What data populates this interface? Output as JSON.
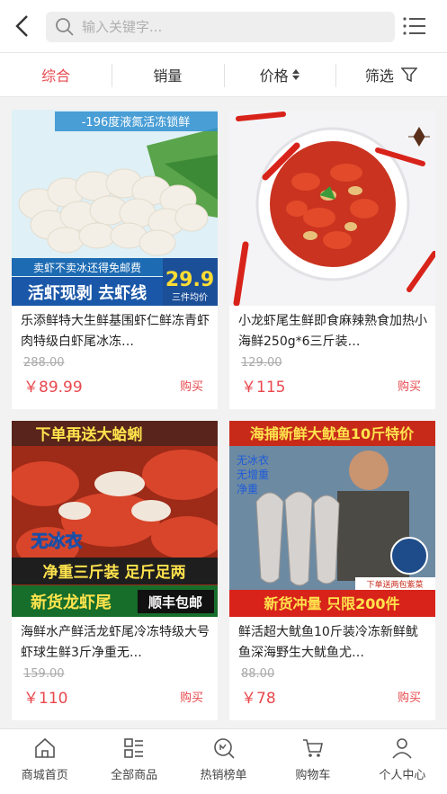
{
  "search": {
    "placeholder": "输入关键字..."
  },
  "sortbar": {
    "items": [
      {
        "label": "综合",
        "active": true
      },
      {
        "label": "销量"
      },
      {
        "label": "价格"
      },
      {
        "label": "筛选"
      }
    ]
  },
  "products": [
    {
      "title": "乐添鲜特大生鲜基围虾仁鲜冻青虾肉特级白虾尾冰冻…",
      "old_price": "288.00",
      "price": "￥89.99",
      "buy": "购买",
      "banner_top": "-196度液氮活冻锁鲜",
      "banner_mid": "卖虾不卖冰还得免邮费",
      "banner_bottom": "活虾现剥 去虾线",
      "badge_price": "29.9",
      "badge_sub": "三件均价"
    },
    {
      "title": "小龙虾尾生鲜即食麻辣熟食加热小海鲜250g*6三斤装…",
      "old_price": "129.00",
      "price": "￥115",
      "buy": "购买"
    },
    {
      "title": "海鲜水产鲜活龙虾尾冷冻特级大号虾球生鲜3斤净重无…",
      "old_price": "159.00",
      "price": "￥110",
      "buy": "购买",
      "banner_top": "下单再送大蛤蜊",
      "banner_mid": "无冰衣",
      "banner_line2": "净重三斤装  足斤足两",
      "banner_bottom": "新货龙虾尾",
      "banner_badge": "顺丰包邮"
    },
    {
      "title": "鲜活超大鱿鱼10斤装冷冻新鲜鱿鱼深海野生大鱿鱼尤…",
      "old_price": "88.00",
      "price": "￥78",
      "buy": "购买",
      "banner_top": "海捕新鲜大鱿鱼10斤特价",
      "banner_checks": [
        "无冰衣",
        "无增重",
        "净重"
      ],
      "banner_tag": "下单送两包紫菜",
      "banner_bottom": "新货冲量  只限200件"
    }
  ],
  "tabbar": {
    "items": [
      {
        "label": "商城首页",
        "icon": "home-icon"
      },
      {
        "label": "全部商品",
        "icon": "grid-list-icon"
      },
      {
        "label": "热销榜单",
        "icon": "hot-search-icon"
      },
      {
        "label": "购物车",
        "icon": "cart-icon"
      },
      {
        "label": "个人中心",
        "icon": "user-icon"
      }
    ]
  },
  "colors": {
    "accent": "#e8484d",
    "background": "#f2f2f2"
  }
}
